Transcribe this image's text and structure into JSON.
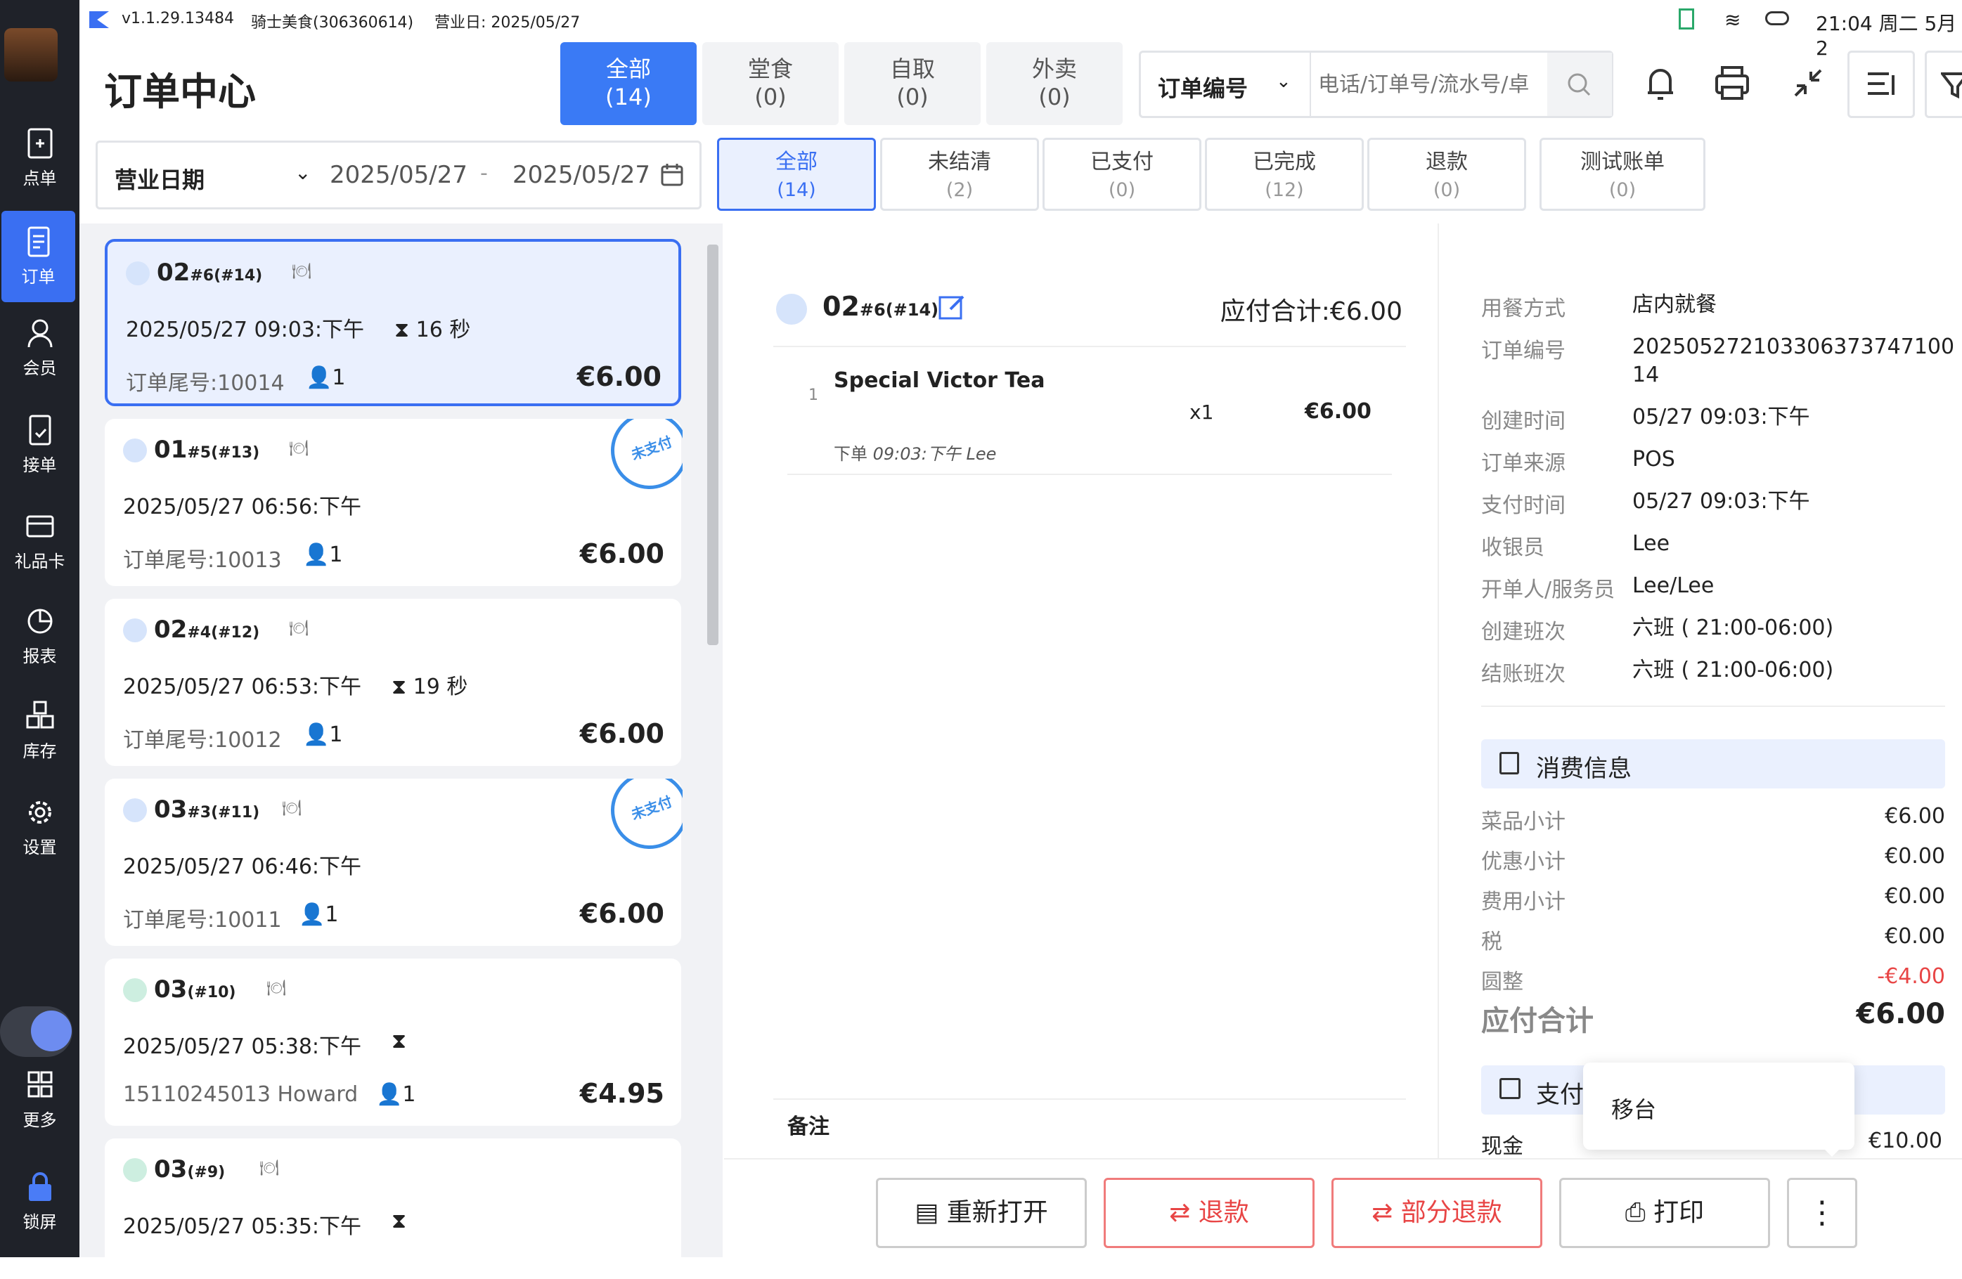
{
  "statusbar": {
    "version": "v1.1.29.13484",
    "store": "骑士美食(306360614)",
    "bizdate": "营业日: 2025/05/27",
    "clock": "21:04 周二 5月 2"
  },
  "header": {
    "title": "订单中心"
  },
  "type_tabs": [
    {
      "label": "全部",
      "count": "(14)"
    },
    {
      "label": "堂食",
      "count": "(0)"
    },
    {
      "label": "自取",
      "count": "(0)"
    },
    {
      "label": "外卖",
      "count": "(0)"
    }
  ],
  "search": {
    "field": "订单编号",
    "placeholder": "电话/订单号/流水号/卓"
  },
  "date_filter": {
    "label": "营业日期",
    "from": "2025/05/27",
    "sep": "-",
    "to": "2025/05/27"
  },
  "status_tabs": [
    {
      "label": "全部",
      "count": "(14)"
    },
    {
      "label": "未结清",
      "count": "(2)"
    },
    {
      "label": "已支付",
      "count": "(0)"
    },
    {
      "label": "已完成",
      "count": "(12)"
    },
    {
      "label": "退款",
      "count": "(0)"
    },
    {
      "label": "测试账单",
      "count": "(0)"
    }
  ],
  "sidebar": [
    {
      "label": "点单"
    },
    {
      "label": "订单"
    },
    {
      "label": "会员"
    },
    {
      "label": "接单"
    },
    {
      "label": "礼品卡"
    },
    {
      "label": "报表"
    },
    {
      "label": "库存"
    },
    {
      "label": "设置"
    },
    {
      "label": "更多"
    },
    {
      "label": "锁屏"
    }
  ],
  "orders": [
    {
      "num": "02",
      "sub": "#6(#14)",
      "time": "2025/05/27 09:03:下午",
      "wait": "16 秒",
      "tail": "订单尾号:10014",
      "people": "1",
      "amount": "€6.00"
    },
    {
      "num": "01",
      "sub": "#5(#13)",
      "time": "2025/05/27 06:56:下午",
      "wait": "",
      "tail": "订单尾号:10013",
      "people": "1",
      "amount": "€6.00",
      "stamp": "未支付"
    },
    {
      "num": "02",
      "sub": "#4(#12)",
      "time": "2025/05/27 06:53:下午",
      "wait": "19 秒",
      "tail": "订单尾号:10012",
      "people": "1",
      "amount": "€6.00"
    },
    {
      "num": "03",
      "sub": "#3(#11)",
      "time": "2025/05/27 06:46:下午",
      "wait": "",
      "tail": "订单尾号:10011",
      "people": "1",
      "amount": "€6.00",
      "stamp": "未支付"
    },
    {
      "num": "03",
      "sub": "(#10)",
      "time": "2025/05/27 05:38:下午",
      "wait": "",
      "tail": "15110245013  Howard",
      "people": "1",
      "amount": "€4.95"
    },
    {
      "num": "03",
      "sub": "(#9)",
      "time": "2025/05/27 05:35:下午",
      "wait": "",
      "tail": "",
      "people": "",
      "amount": ""
    }
  ],
  "detail": {
    "num": "02",
    "sub": "#6(#14)",
    "total": "应付合计:€6.00",
    "item_index": "1",
    "item_name": "Special Victor Tea",
    "qty": "x1",
    "price": "€6.00",
    "meta_label": "下单",
    "meta_time": "09:03:下午",
    "meta_user": "Lee",
    "remark": "备注"
  },
  "info": [
    {
      "k": "用餐方式",
      "v": "店内就餐"
    },
    {
      "k": "订单编号",
      "v": "20250527210330637374710014"
    },
    {
      "k": "创建时间",
      "v": "05/27 09:03:下午"
    },
    {
      "k": "订单来源",
      "v": "POS"
    },
    {
      "k": "支付时间",
      "v": "05/27 09:03:下午"
    },
    {
      "k": "收银员",
      "v": "Lee"
    },
    {
      "k": "开单人/服务员",
      "v": "Lee/Lee"
    },
    {
      "k": "创建班次",
      "v": "六班 ( 21:00-06:00)"
    },
    {
      "k": "结账班次",
      "v": "六班 ( 21:00-06:00)"
    }
  ],
  "consume": {
    "title": "消费信息",
    "rows": [
      {
        "k": "菜品小计",
        "v": "€6.00"
      },
      {
        "k": "优惠小计",
        "v": "€0.00"
      },
      {
        "k": "费用小计",
        "v": "€0.00"
      },
      {
        "k": "税",
        "v": "€0.00"
      },
      {
        "k": "圆整",
        "v": "-€4.00"
      }
    ],
    "total_k": "应付合计",
    "total_v": "€6.00"
  },
  "payment": {
    "title": "支付",
    "method": "现金",
    "amount": "€10.00"
  },
  "popup": {
    "label": "移台"
  },
  "actions": {
    "reopen": "重新打开",
    "refund": "退款",
    "partial": "部分退款",
    "print": "打印"
  }
}
